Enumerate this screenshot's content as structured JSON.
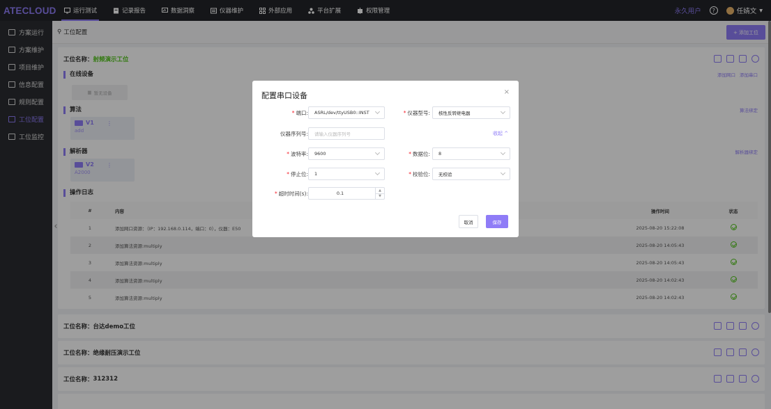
{
  "brand": "ATECLOUD",
  "nav": [
    {
      "label": "运行测试",
      "icon": "monitor-icon",
      "active": true
    },
    {
      "label": "记录报告",
      "icon": "document-icon"
    },
    {
      "label": "数据洞察",
      "icon": "chart-icon"
    },
    {
      "label": "仪器维护",
      "icon": "instrument-icon"
    },
    {
      "label": "外部应用",
      "icon": "apps-grid-icon"
    },
    {
      "label": "平台扩展",
      "icon": "extension-icon"
    },
    {
      "label": "权限管理",
      "icon": "permission-icon"
    }
  ],
  "topright": {
    "permanent_user": "永久用户",
    "help": "?",
    "username": "任婧文"
  },
  "sidebar": [
    {
      "label": "方案运行"
    },
    {
      "label": "方案维护"
    },
    {
      "label": "项目维护"
    },
    {
      "label": "信息配置"
    },
    {
      "label": "规则配置"
    },
    {
      "label": "工位配置",
      "active": true
    },
    {
      "label": "工位监控"
    }
  ],
  "breadcrumb": {
    "label": "工位配置"
  },
  "add_station_button": "+ 添加工位",
  "station_main": {
    "name_label": "工位名称：",
    "name": "射频演示工位",
    "online_devices": {
      "title": "在线设备",
      "add_network_port": "添加网口",
      "add_serial_port": "添加串口",
      "empty": "暂无设备"
    },
    "algorithm": {
      "title": "算法",
      "link": "算法绑定",
      "version": "V1",
      "name": "add"
    },
    "parser": {
      "title": "解析器",
      "link": "解析器绑定",
      "version": "V2",
      "name": "A2000"
    },
    "log": {
      "title": "操作日志",
      "columns": [
        "#",
        "内容",
        "操作时间",
        "状态"
      ],
      "rows": [
        {
          "num": "1",
          "content": "添加网口资源：（IP：192.168.0.114，端口：0），仪器：E50",
          "time": "2025-08-20 15:22:08"
        },
        {
          "num": "2",
          "content": "添加算法资源:multiply",
          "time": "2025-08-20 14:05:43"
        },
        {
          "num": "3",
          "content": "添加算法资源:multiply",
          "time": "2025-08-20 14:05:43"
        },
        {
          "num": "4",
          "content": "添加算法资源:multiply",
          "time": "2025-08-20 14:02:43"
        },
        {
          "num": "5",
          "content": "添加算法资源:multiply",
          "time": "2025-08-20 14:02:43"
        }
      ]
    }
  },
  "other_stations": [
    {
      "name_label": "工位名称：",
      "name": "台达demo工位"
    },
    {
      "name_label": "工位名称：",
      "name": "绝缘耐压演示工位"
    },
    {
      "name_label": "工位名称：",
      "name": "312312"
    }
  ],
  "modal": {
    "title": "配置串口设备",
    "close": "×",
    "port": {
      "label": "端口:",
      "value": "ASRL/dev/ttyUSB0::INST"
    },
    "instrument_model": {
      "label": "仪器型号:",
      "value": "核性反转继电器"
    },
    "serial_number": {
      "label": "仪器序列号:",
      "placeholder": "请输入仪器序列号"
    },
    "collapse": "收起 ^",
    "baud_rate": {
      "label": "波特率:",
      "value": "9600"
    },
    "data_bits": {
      "label": "数据位:",
      "value": "8"
    },
    "stop_bits": {
      "label": "停止位:",
      "value": "1"
    },
    "parity": {
      "label": "校验位:",
      "value": "无校验"
    },
    "timeout": {
      "label": "超时时间(s):",
      "value": "0.1"
    },
    "cancel": "取消",
    "save": "保存"
  },
  "colors": {
    "accent": "#8f7cf7",
    "success": "#52c41a",
    "nav_bg": "#232529",
    "sidebar_bg": "#2b2d31"
  }
}
